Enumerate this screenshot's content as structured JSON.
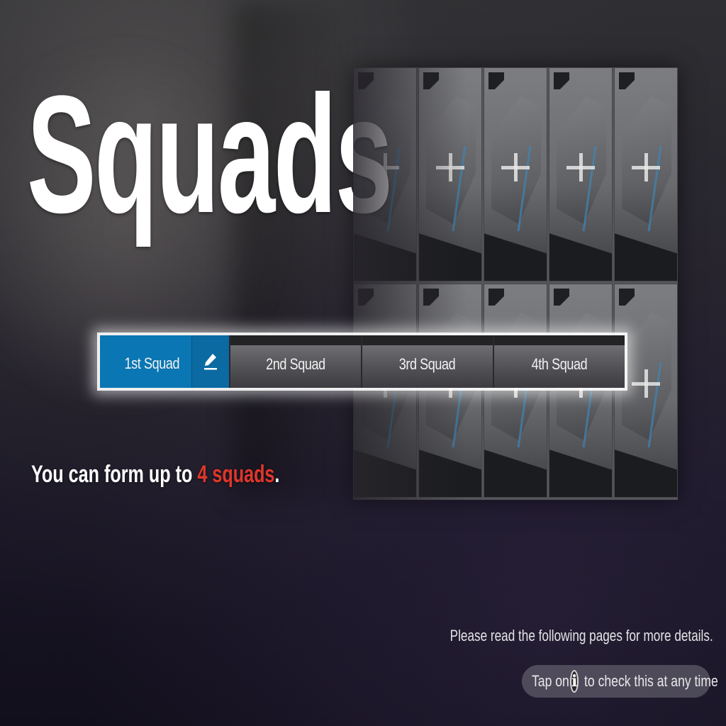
{
  "title": "Squads",
  "tabs": [
    {
      "label": "1st Squad",
      "active": true
    },
    {
      "label": "2nd Squad",
      "active": false
    },
    {
      "label": "3rd Squad",
      "active": false
    },
    {
      "label": "4th Squad",
      "active": false
    }
  ],
  "icons": {
    "edit": "pencil-icon",
    "info": "info-icon",
    "slot": "plus-icon"
  },
  "info": {
    "prefix": "You can form up to ",
    "highlight": "4 squads",
    "suffix": "."
  },
  "details": "Please read the following pages for more details.",
  "hint": {
    "before": "Tap on",
    "icon_glyph": "i",
    "after": "to check this at any time"
  },
  "colors": {
    "active_tab": "#0a76b3",
    "accent": "#e0362a"
  }
}
